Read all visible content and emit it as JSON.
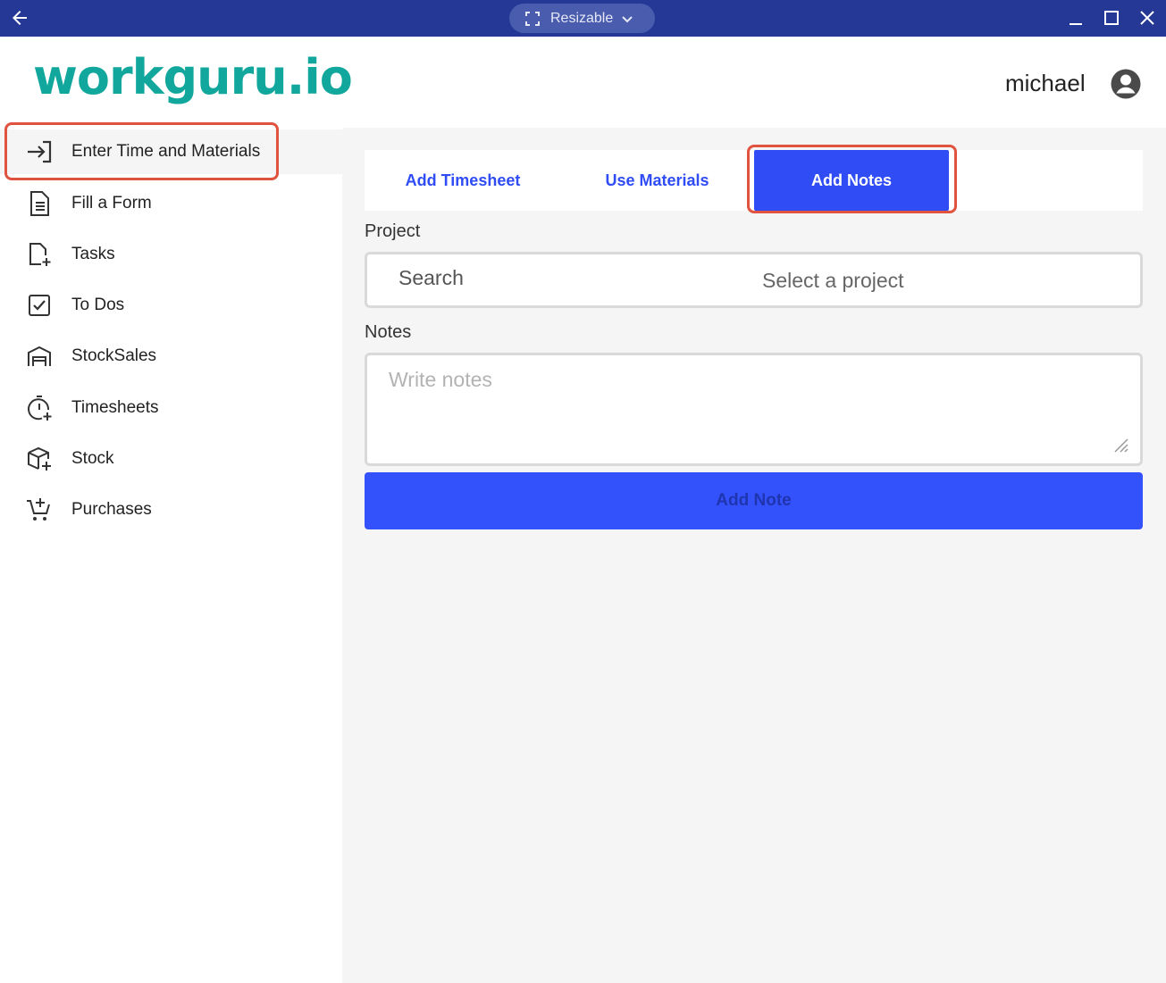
{
  "titlebar": {
    "back_icon": "arrow-left-icon",
    "resize_label": "Resizable",
    "controls": [
      "minimize-icon",
      "maximize-icon",
      "close-icon"
    ]
  },
  "header": {
    "logo_text": "workguru.io",
    "user_name": "michael",
    "avatar_icon": "account-circle-icon"
  },
  "sidebar": {
    "items": [
      {
        "label": "Enter Time and Materials",
        "icon": "login-arrow-icon",
        "active": true
      },
      {
        "label": "Fill a Form",
        "icon": "document-icon"
      },
      {
        "label": "Tasks",
        "icon": "file-add-icon"
      },
      {
        "label": "To Dos",
        "icon": "checkbox-icon"
      },
      {
        "label": "StockSales",
        "icon": "warehouse-icon"
      },
      {
        "label": "Timesheets",
        "icon": "timer-add-icon"
      },
      {
        "label": "Stock",
        "icon": "package-add-icon"
      },
      {
        "label": "Purchases",
        "icon": "cart-add-icon"
      }
    ]
  },
  "main": {
    "tabs": [
      {
        "label": "Add Timesheet"
      },
      {
        "label": "Use Materials"
      },
      {
        "label": "Add Notes",
        "active": true
      }
    ],
    "project_label": "Project",
    "project_search_placeholder": "Search",
    "project_select_text": "Select a project",
    "notes_label": "Notes",
    "notes_placeholder": "Write notes",
    "add_note_label": "Add Note"
  },
  "colors": {
    "titlebar": "#263896",
    "brand_teal": "#11a79d",
    "accent_blue": "#2f4cf5",
    "highlight_red": "#e0533f"
  }
}
